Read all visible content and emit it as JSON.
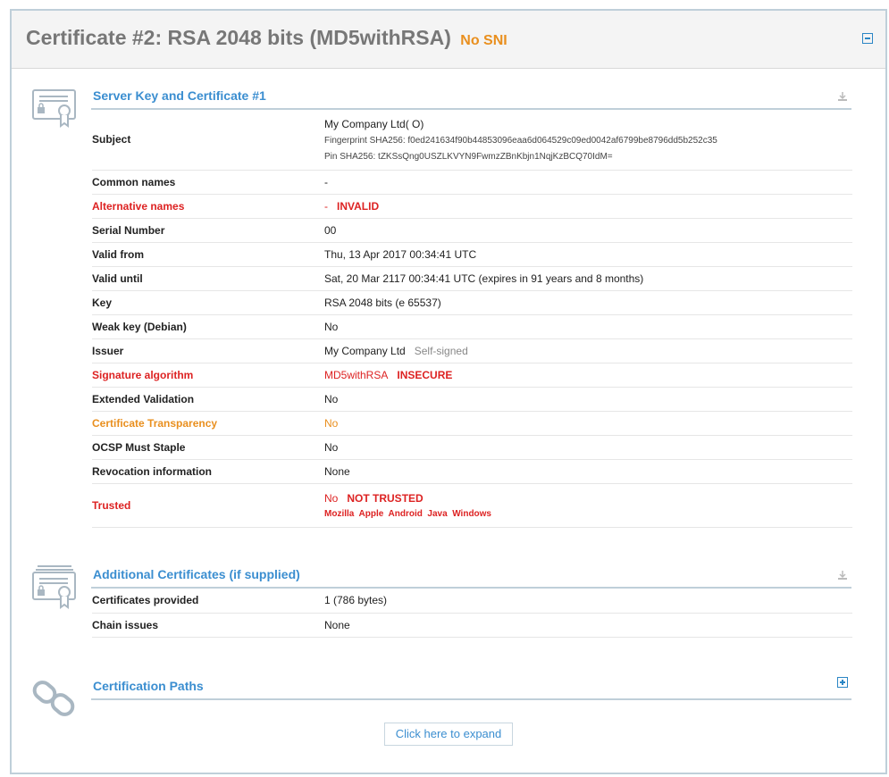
{
  "header": {
    "title": "Certificate #2: RSA 2048 bits (MD5withRSA)",
    "badge": "No SNI"
  },
  "colors": {
    "accent": "#3b8ed0",
    "danger": "#dd2222",
    "warning": "#e98f1e",
    "border": "#bfcfd9"
  },
  "server_cert": {
    "title": "Server Key and Certificate #1",
    "subject": {
      "label": "Subject",
      "name": "My Company Ltd( O)",
      "fingerprint": "Fingerprint SHA256: f0ed241634f90b44853096eaa6d064529c09ed0042af6799be8796dd5b252c35",
      "pin": "Pin SHA256: tZKSsQng0USZLKVYN9FwmzZBnKbjn1NqjKzBCQ70IdM="
    },
    "common_names": {
      "label": "Common names",
      "value": "-"
    },
    "alt_names": {
      "label": "Alternative names",
      "value": "-",
      "flag": "INVALID"
    },
    "serial": {
      "label": "Serial Number",
      "value": "00"
    },
    "valid_from": {
      "label": "Valid from",
      "value": "Thu, 13 Apr 2017 00:34:41 UTC"
    },
    "valid_until": {
      "label": "Valid until",
      "value": "Sat, 20 Mar 2117 00:34:41 UTC (expires in 91 years and 8 months)"
    },
    "key": {
      "label": "Key",
      "value": "RSA 2048 bits (e 65537)"
    },
    "weak_key": {
      "label": "Weak key (Debian)",
      "value": "No"
    },
    "issuer": {
      "label": "Issuer",
      "value": "My Company Ltd",
      "note": "Self-signed"
    },
    "sig_alg": {
      "label": "Signature algorithm",
      "value": "MD5withRSA",
      "flag": "INSECURE"
    },
    "ev": {
      "label": "Extended Validation",
      "value": "No"
    },
    "ct": {
      "label": "Certificate Transparency",
      "value": "No"
    },
    "ocsp": {
      "label": "OCSP Must Staple",
      "value": "No"
    },
    "revocation": {
      "label": "Revocation information",
      "value": "None"
    },
    "trusted": {
      "label": "Trusted",
      "value": "No",
      "flag": "NOT TRUSTED",
      "stores": [
        "Mozilla",
        "Apple",
        "Android",
        "Java",
        "Windows"
      ]
    }
  },
  "additional_certs": {
    "title": "Additional Certificates (if supplied)",
    "provided": {
      "label": "Certificates provided",
      "value": "1 (786 bytes)"
    },
    "chain": {
      "label": "Chain issues",
      "value": "None"
    }
  },
  "paths": {
    "title": "Certification Paths",
    "expand_label": "Click here to expand"
  }
}
